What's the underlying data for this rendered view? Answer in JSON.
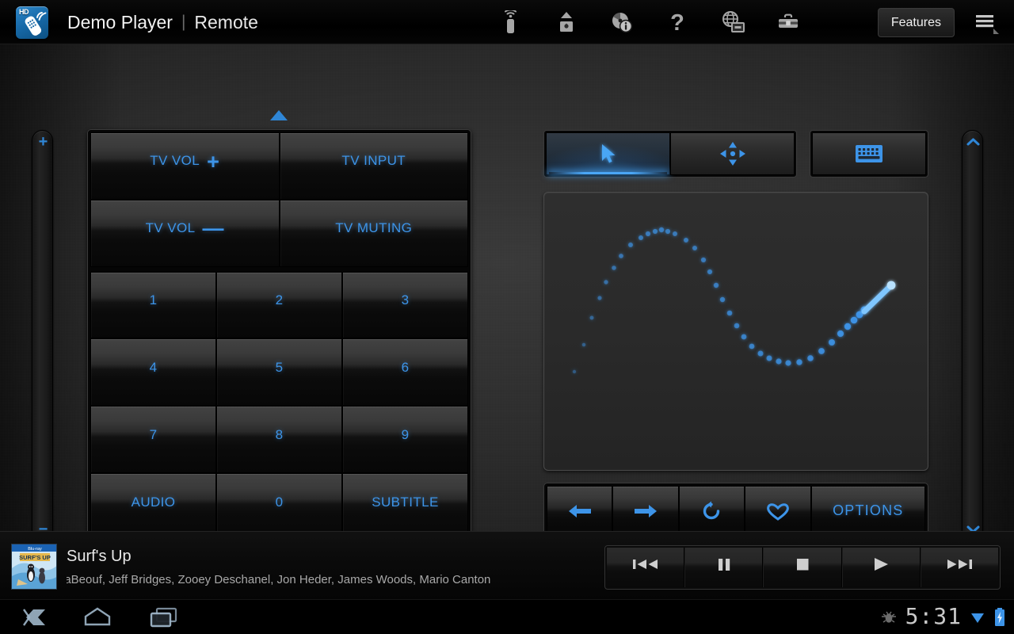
{
  "app": {
    "icon_name": "hd-remote-app-icon",
    "icon_badge": "HD",
    "title": "Demo Player",
    "title_separator": "|",
    "subtitle": "Remote"
  },
  "actionbar": {
    "icons": [
      {
        "name": "remote-signal-icon",
        "label": "Remote"
      },
      {
        "name": "eject-disc-icon",
        "label": "Eject"
      },
      {
        "name": "disc-info-icon",
        "label": "Disc Info"
      },
      {
        "name": "help-icon",
        "label": "Help"
      },
      {
        "name": "network-media-icon",
        "label": "Network Media"
      },
      {
        "name": "toolbox-icon",
        "label": "Tools"
      }
    ],
    "features_label": "Features",
    "overflow_name": "overflow-menu-icon"
  },
  "left_rocker": {
    "name": "volume-rocker",
    "plus": "+",
    "minus": "−"
  },
  "right_rocker": {
    "name": "channel-rocker",
    "up": "▲",
    "down": "▼"
  },
  "scroll": {
    "up_name": "scroll-up-triangle",
    "down_name": "scroll-down-triangle"
  },
  "keypad": {
    "rows": [
      [
        {
          "name": "tv-vol-up-button",
          "label": "TV VOL",
          "symbol": "+"
        },
        {
          "name": "tv-input-button",
          "label": "TV INPUT",
          "symbol": ""
        }
      ],
      [
        {
          "name": "tv-vol-down-button",
          "label": "TV VOL",
          "symbol": "—"
        },
        {
          "name": "tv-muting-button",
          "label": "TV MUTING",
          "symbol": ""
        }
      ],
      [
        {
          "name": "key-1-button",
          "label": "1",
          "symbol": ""
        },
        {
          "name": "key-2-button",
          "label": "2",
          "symbol": ""
        },
        {
          "name": "key-3-button",
          "label": "3",
          "symbol": ""
        }
      ],
      [
        {
          "name": "key-4-button",
          "label": "4",
          "symbol": ""
        },
        {
          "name": "key-5-button",
          "label": "5",
          "symbol": ""
        },
        {
          "name": "key-6-button",
          "label": "6",
          "symbol": ""
        }
      ],
      [
        {
          "name": "key-7-button",
          "label": "7",
          "symbol": ""
        },
        {
          "name": "key-8-button",
          "label": "8",
          "symbol": ""
        },
        {
          "name": "key-9-button",
          "label": "9",
          "symbol": ""
        }
      ],
      [
        {
          "name": "audio-button",
          "label": "AUDIO",
          "symbol": ""
        },
        {
          "name": "key-0-button",
          "label": "0",
          "symbol": ""
        },
        {
          "name": "subtitle-button",
          "label": "SUBTITLE",
          "symbol": ""
        }
      ]
    ]
  },
  "modes": {
    "tabs": [
      {
        "name": "tab-pointer-mode",
        "icon": "mouse-pointer-icon",
        "selected": true
      },
      {
        "name": "tab-dpad-mode",
        "icon": "dpad-arrows-icon",
        "selected": false
      }
    ],
    "keyboard_button": {
      "name": "keyboard-button",
      "icon": "keyboard-icon"
    }
  },
  "touchpad": {
    "name": "touchpad-surface",
    "accent": "#3d94e8"
  },
  "nav_buttons": [
    {
      "name": "browser-back-button",
      "icon": "arrow-left-icon",
      "label": ""
    },
    {
      "name": "browser-forward-button",
      "icon": "arrow-right-icon",
      "label": ""
    },
    {
      "name": "browser-reload-button",
      "icon": "refresh-icon",
      "label": ""
    },
    {
      "name": "favorite-button",
      "icon": "heart-icon",
      "label": ""
    },
    {
      "name": "options-button",
      "icon": "",
      "label": "OPTIONS"
    }
  ],
  "now_playing": {
    "cover_name": "album-cover-art",
    "title": "Surf's Up",
    "cast": "laBeouf, Jeff Bridges, Zooey Deschanel, Jon Heder, James Woods, Mario Canton"
  },
  "transport": [
    {
      "name": "previous-button",
      "icon": "skip-back-icon"
    },
    {
      "name": "pause-button",
      "icon": "pause-icon"
    },
    {
      "name": "stop-button",
      "icon": "stop-icon"
    },
    {
      "name": "play-button",
      "icon": "play-icon"
    },
    {
      "name": "next-button",
      "icon": "skip-forward-icon"
    }
  ],
  "system_bar": {
    "back_name": "system-back-icon",
    "home_name": "system-home-icon",
    "recents_name": "system-recents-icon",
    "usb_debug_name": "usb-debug-icon",
    "time": "5:31",
    "wifi_name": "wifi-signal-icon",
    "battery_name": "battery-charging-icon"
  },
  "colors": {
    "accent_blue": "#3d94e8",
    "bright_blue": "#4aa6f5",
    "text_light": "#e9e9e9",
    "text_dim": "#a8a8a8"
  }
}
